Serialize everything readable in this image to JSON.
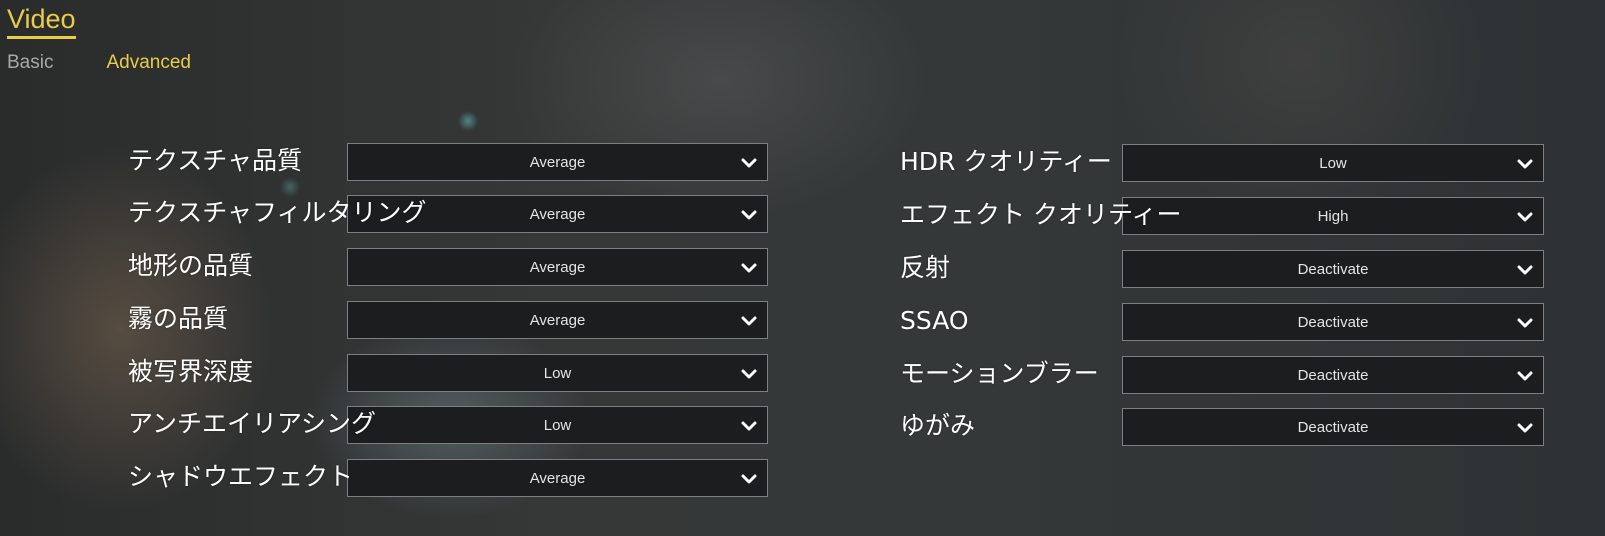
{
  "header": {
    "title": "Video"
  },
  "tabs": [
    {
      "label": "Basic",
      "active": false
    },
    {
      "label": "Advanced",
      "active": true
    }
  ],
  "colors": {
    "accent": "#e8cc4a",
    "inactive_tab": "#a8a8a8",
    "label": "#ffffff",
    "dropdown_bg": "#1c1d1e",
    "dropdown_border": "#7b8082"
  },
  "settings_left": [
    {
      "label": "テクスチャ品質",
      "value": "Average",
      "icon": "chevron-down-icon"
    },
    {
      "label": "テクスチャフィルタリング",
      "value": "Average",
      "icon": "chevron-down-icon"
    },
    {
      "label": "地形の品質",
      "value": "Average",
      "icon": "chevron-down-icon"
    },
    {
      "label": "霧の品質",
      "value": "Average",
      "icon": "chevron-down-icon"
    },
    {
      "label": "被写界深度",
      "value": "Low",
      "icon": "chevron-down-icon"
    },
    {
      "label": "アンチエイリアシング",
      "value": "Low",
      "icon": "chevron-down-icon"
    },
    {
      "label": "シャドウエフェクト",
      "value": "Average",
      "icon": "chevron-down-icon"
    }
  ],
  "settings_right": [
    {
      "label": "HDR クオリティー",
      "value": "Low",
      "icon": "chevron-down-icon"
    },
    {
      "label": "エフェクト クオリティー",
      "value": "High",
      "icon": "chevron-down-icon"
    },
    {
      "label": "反射",
      "value": "Deactivate",
      "icon": "chevron-down-icon"
    },
    {
      "label": "SSAO",
      "value": "Deactivate",
      "icon": "chevron-down-icon"
    },
    {
      "label": "モーションブラー",
      "value": "Deactivate",
      "icon": "chevron-down-icon"
    },
    {
      "label": "ゆがみ",
      "value": "Deactivate",
      "icon": "chevron-down-icon"
    }
  ]
}
